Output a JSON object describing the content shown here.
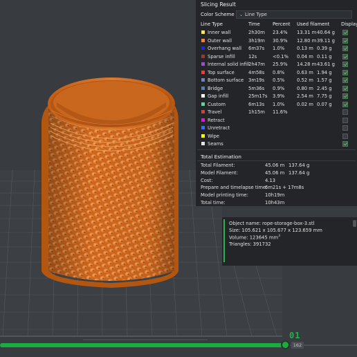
{
  "panel": {
    "title": "Slicing Result",
    "color_scheme_label": "Color Scheme",
    "color_scheme_value": "Line Type",
    "headers": {
      "line_type": "Line Type",
      "time": "Time",
      "percent": "Percent",
      "used_filament": "Used filament",
      "display": "Display"
    },
    "rows": [
      {
        "name": "Inner wall",
        "color": "#ffe64d",
        "time": "2h30m",
        "percent": "23.4%",
        "length": "13.31 m",
        "weight": "40.64 g",
        "display": true
      },
      {
        "name": "Outer wall",
        "color": "#ff7d38",
        "time": "3h19m",
        "percent": "30.9%",
        "length": "12.80 m",
        "weight": "39.11 g",
        "display": true
      },
      {
        "name": "Overhang wall",
        "color": "#1f1fff",
        "time": "6m37s",
        "percent": "1.0%",
        "length": "0.13 m",
        "weight": "0.39 g",
        "display": true
      },
      {
        "name": "Sparse infill",
        "color": "#b03029",
        "time": "12s",
        "percent": "<0.1%",
        "length": "0.04 m",
        "weight": "0.11 g",
        "display": true
      },
      {
        "name": "Internal solid infill",
        "color": "#9654cc",
        "time": "2h47m",
        "percent": "25.9%",
        "length": "14.28 m",
        "weight": "43.61 g",
        "display": true
      },
      {
        "name": "Top surface",
        "color": "#f03c3c",
        "time": "4m58s",
        "percent": "0.8%",
        "length": "0.63 m",
        "weight": "1.94 g",
        "display": true
      },
      {
        "name": "Bottom surface",
        "color": "#6e7fe0",
        "time": "3m19s",
        "percent": "0.5%",
        "length": "0.52 m",
        "weight": "1.57 g",
        "display": true
      },
      {
        "name": "Bridge",
        "color": "#4d80ba",
        "time": "5m36s",
        "percent": "0.9%",
        "length": "0.80 m",
        "weight": "2.45 g",
        "display": true
      },
      {
        "name": "Gap infill",
        "color": "#ffffff",
        "time": "25m17s",
        "percent": "3.9%",
        "length": "2.54 m",
        "weight": "7.75 g",
        "display": true
      },
      {
        "name": "Custom",
        "color": "#5ed6a2",
        "time": "6m13s",
        "percent": "1.0%",
        "length": "0.02 m",
        "weight": "0.07 g",
        "display": true
      },
      {
        "name": "Travel",
        "color": "#e83a30",
        "time": "1h15m",
        "percent": "11.6%",
        "length": "",
        "weight": "",
        "display": false
      },
      {
        "name": "Retract",
        "color": "#ff00ff",
        "time": "",
        "percent": "",
        "length": "",
        "weight": "",
        "display": false
      },
      {
        "name": "Unretract",
        "color": "#3a6cff",
        "time": "",
        "percent": "",
        "length": "",
        "weight": "",
        "display": false
      },
      {
        "name": "Wipe",
        "color": "#ffff00",
        "time": "",
        "percent": "",
        "length": "",
        "weight": "",
        "display": false
      },
      {
        "name": "Seams",
        "color": "#e6e6e6",
        "time": "",
        "percent": "",
        "length": "",
        "weight": "",
        "display": true
      }
    ]
  },
  "estimation": {
    "title": "Total Estimation",
    "rows": [
      {
        "label": "Total Filament:",
        "v1": "45.06 m",
        "v2": "137.64 g"
      },
      {
        "label": "Model Filament:",
        "v1": "45.06 m",
        "v2": "137.64 g"
      },
      {
        "label": "Cost:",
        "v1": "4.13",
        "v2": ""
      },
      {
        "label": "Prepare and timelapse time:",
        "v1": "6m21s + 17m8s",
        "v2": ""
      },
      {
        "label": "Model printing time:",
        "v1": "10h19m",
        "v2": ""
      },
      {
        "label": "Total time:",
        "v1": "10h43m",
        "v2": ""
      }
    ]
  },
  "object_info": {
    "name_line": "Object name: rope-storage-box-3.stl",
    "size_line": "Size: 105.621 x 105.677 x 123.659 mm",
    "volume_line": "Volume: 123645 mm",
    "volume_sup": "3",
    "triangles_line": "Triangles: 391732"
  },
  "slider": {
    "layer_top": "01",
    "layer_value": "162",
    "progress": 0.8
  },
  "colors": {
    "model": "#d36a1f",
    "accent": "#17ae3f",
    "panel_bg": "#232529",
    "viewport_bg": "#383b40"
  }
}
